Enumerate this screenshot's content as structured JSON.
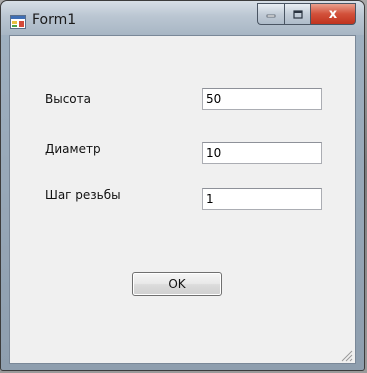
{
  "window": {
    "title": "Form1",
    "icons": {
      "app": "form-app-icon",
      "minimize": "minimize-icon",
      "maximize": "maximize-icon",
      "close": "close-icon",
      "grip": "resize-grip-icon"
    },
    "close_glyph": "x"
  },
  "form": {
    "height_label": "Высота",
    "height_value": "50",
    "diameter_label": "Диаметр",
    "diameter_value": "10",
    "pitch_label": "Шаг резьбы",
    "pitch_value": "1",
    "ok_label": "OK"
  },
  "colors": {
    "close_button": "#c0321e",
    "client_background": "#f0f0f0",
    "title_bar": "#bac6d2"
  }
}
